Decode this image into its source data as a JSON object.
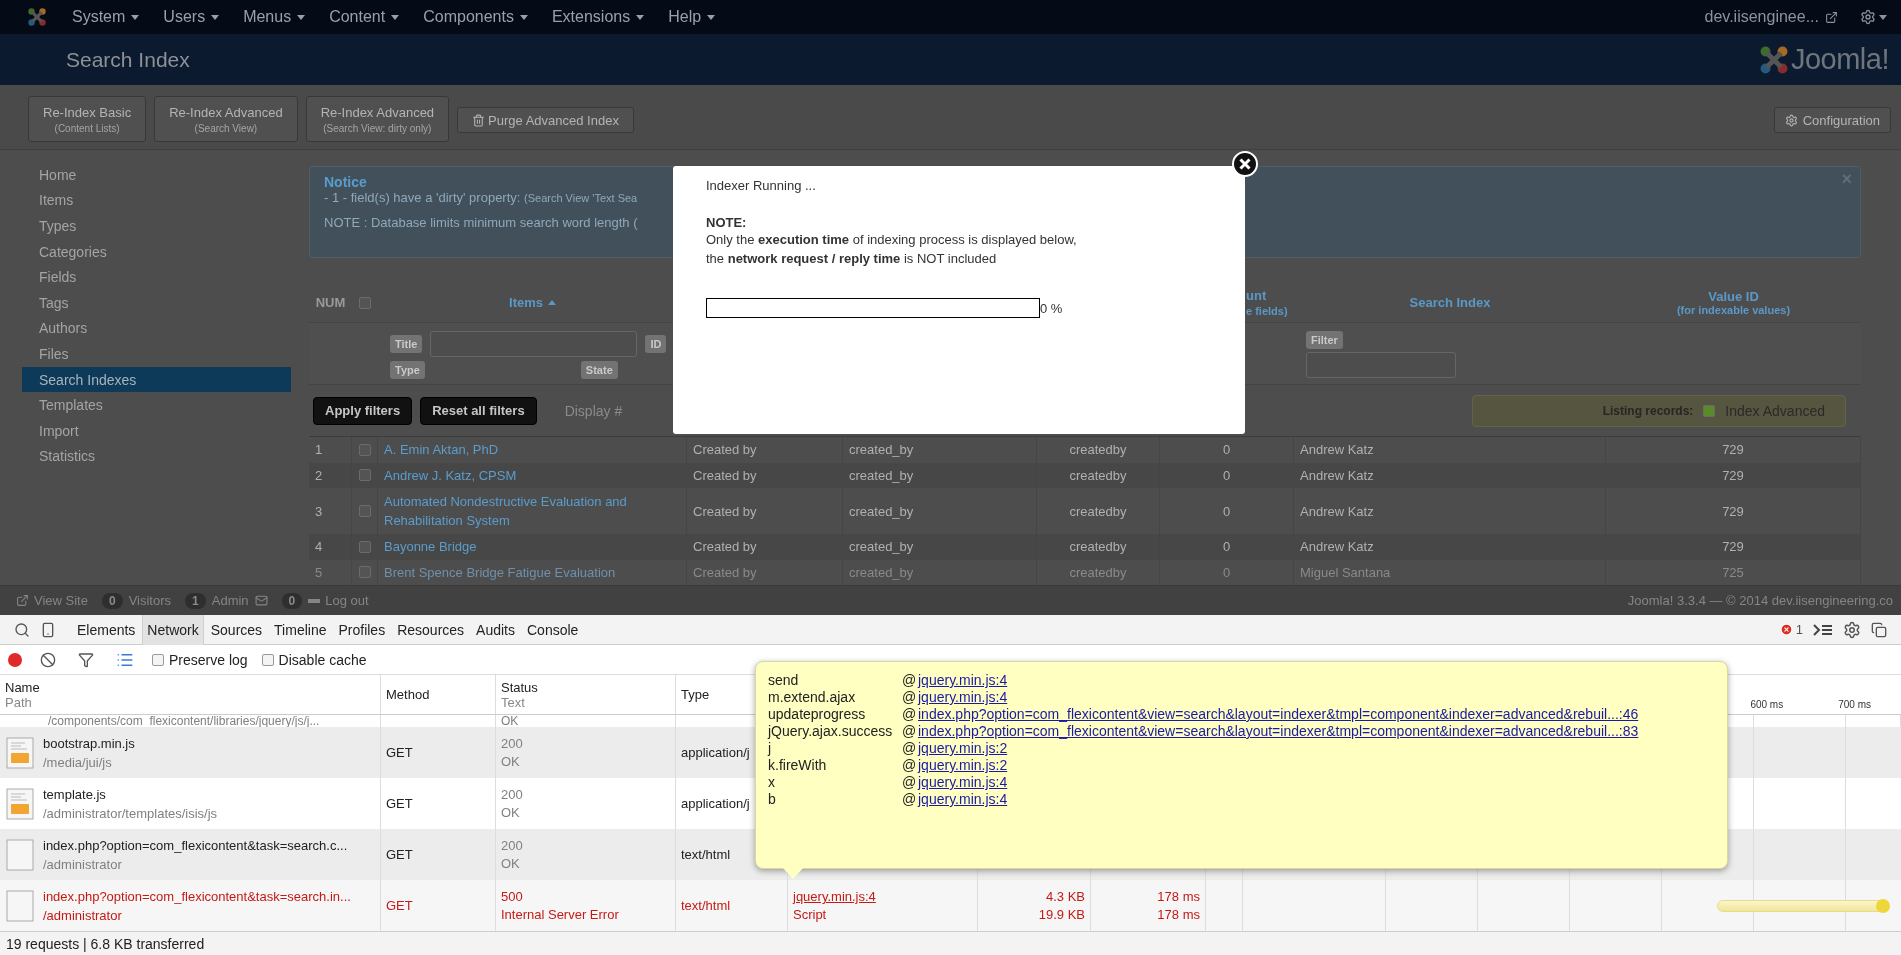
{
  "top_menu": {
    "items": [
      {
        "label": "System"
      },
      {
        "label": "Users"
      },
      {
        "label": "Menus"
      },
      {
        "label": "Content"
      },
      {
        "label": "Components"
      },
      {
        "label": "Extensions"
      },
      {
        "label": "Help"
      }
    ],
    "site_link": "dev.iisenginee..."
  },
  "header": {
    "title": "Search Index",
    "logo_text": "Joomla!"
  },
  "toolbar": {
    "buttons": [
      {
        "kind": "stacked",
        "label": "Re-Index Basic",
        "sublabel": "(Content Lists)"
      },
      {
        "kind": "stacked",
        "label": "Re-Index Advanced",
        "sublabel": "(Search View)"
      },
      {
        "kind": "stacked",
        "label": "Re-Index Advanced",
        "sublabel": "(Search View: dirty only)"
      },
      {
        "kind": "trash",
        "label": "Purge Advanced Index"
      }
    ],
    "configuration": "Configuration"
  },
  "sidebar": {
    "items": [
      {
        "label": "Home",
        "selected": false
      },
      {
        "label": "Items",
        "selected": false
      },
      {
        "label": "Types",
        "selected": false
      },
      {
        "label": "Categories",
        "selected": false
      },
      {
        "label": "Fields",
        "selected": false
      },
      {
        "label": "Tags",
        "selected": false
      },
      {
        "label": "Authors",
        "selected": false
      },
      {
        "label": "Files",
        "selected": false
      },
      {
        "label": "Search Indexes",
        "selected": true
      },
      {
        "label": "Templates",
        "selected": false
      },
      {
        "label": "Import",
        "selected": false
      },
      {
        "label": "Statistics",
        "selected": false
      }
    ]
  },
  "notice": {
    "title": "Notice",
    "line_1": "- 1 - field(s) have a 'dirty' property: ",
    "line_1_detail": "(Search View 'Text Sea",
    "line_2": "NOTE : Database limits minimum search word length (",
    "close": "×"
  },
  "table": {
    "num": "NUM",
    "all_checked": false,
    "items": "Items",
    "count_title": "unt",
    "count_sub": "e fields)",
    "search_index": "Search Index",
    "value_id": "Value ID",
    "value_id_sub": "(for indexable values)"
  },
  "filters": {
    "title_label": "Title",
    "id_label": "ID",
    "type_label": "Type",
    "state_label": "State",
    "filter_label": "Filter"
  },
  "actions": {
    "apply": "Apply filters",
    "reset": "Reset all filters",
    "display": "Display #",
    "listing_label": "Listing records:",
    "listing_option": "Index Advanced",
    "listing_checked": true
  },
  "rows": [
    {
      "num": "1",
      "checked": false,
      "faded": false,
      "title": "A. Emin Aktan, PhD",
      "field": "Created by",
      "field_name": "created_by",
      "index": "createdby",
      "count": "0",
      "value": "Andrew Katz",
      "value_id": "729"
    },
    {
      "num": "2",
      "checked": false,
      "faded": false,
      "title": "Andrew J. Katz, CPSM",
      "field": "Created by",
      "field_name": "created_by",
      "index": "createdby",
      "count": "0",
      "value": "Andrew Katz",
      "value_id": "729"
    },
    {
      "num": "3",
      "checked": false,
      "faded": false,
      "title": "Automated Nondestructive Evaluation and Rehabilitation System",
      "field": "Created by",
      "field_name": "created_by",
      "index": "createdby",
      "count": "0",
      "value": "Andrew Katz",
      "value_id": "729"
    },
    {
      "num": "4",
      "checked": false,
      "faded": false,
      "title": "Bayonne Bridge",
      "field": "Created by",
      "field_name": "created_by",
      "index": "createdby",
      "count": "0",
      "value": "Andrew Katz",
      "value_id": "729"
    },
    {
      "num": "5",
      "checked": false,
      "faded": true,
      "title": "Brent Spence Bridge Fatigue Evaluation",
      "field": "Created by",
      "field_name": "created_by",
      "index": "createdby",
      "count": "0",
      "value": "Miguel Santana",
      "value_id": "725"
    }
  ],
  "footer": {
    "view_site": "View Site",
    "visitors_count": "0",
    "visitors": "Visitors",
    "admin_count": "1",
    "admin": "Admin",
    "messages_count": "0",
    "logout": "Log out",
    "copyright": "Joomla! 3.3.4 — © 2014 dev.iisengineering.co"
  },
  "modal": {
    "title": "Indexer Running ...",
    "note_label": "NOTE:",
    "note_line_1": "Only the **execution time** of indexing process is displayed below,",
    "note_line_2": "the **network request / reply time** is NOT included",
    "progress": {
      "level": 0,
      "reading": "0 %"
    }
  },
  "devtools": {
    "tabs": [
      {
        "label": "Elements",
        "selected": false
      },
      {
        "label": "Network",
        "selected": true
      },
      {
        "label": "Sources",
        "selected": false
      },
      {
        "label": "Timeline",
        "selected": false
      },
      {
        "label": "Profiles",
        "selected": false
      },
      {
        "label": "Resources",
        "selected": false
      },
      {
        "label": "Audits",
        "selected": false
      },
      {
        "label": "Console",
        "selected": false
      }
    ],
    "error_count": "1",
    "recording": true,
    "options": [
      {
        "label": "Preserve log",
        "checked": false
      },
      {
        "label": "Disable cache",
        "checked": false
      }
    ],
    "columns": {
      "name": "Name",
      "path": "Path",
      "method": "Method",
      "status": "Status",
      "text": "Text",
      "type": "Type",
      "ticks": [
        "600 ms",
        "700 ms"
      ]
    },
    "requests": [
      {
        "kind": "partial",
        "path": "/components/com_flexicontent/libraries/jquery/js/j...",
        "status_text": "OK"
      },
      {
        "kind": "script",
        "error": false,
        "timeline_bar": false,
        "name": "bootstrap.min.js",
        "path": "/media/jui/js",
        "method": "GET",
        "status": "200",
        "status_text": "OK",
        "type": "application/j"
      },
      {
        "kind": "script",
        "error": false,
        "timeline_bar": false,
        "name": "template.js",
        "path": "/administrator/templates/isis/js",
        "method": "GET",
        "status": "200",
        "status_text": "OK",
        "type": "application/j"
      },
      {
        "kind": "document",
        "error": false,
        "timeline_bar": false,
        "name": "index.php?option=com_flexicontent&task=search.c...",
        "path": "/administrator",
        "method": "GET",
        "status": "200",
        "status_text": "OK",
        "type": "text/html"
      },
      {
        "kind": "document",
        "error": true,
        "timeline_bar": true,
        "name": "index.php?option=com_flexicontent&task=search.in...",
        "path": "/administrator",
        "method": "GET",
        "status": "500",
        "status_text": "Internal Server Error",
        "type": "text/html",
        "initiator": "jquery.min.js:4",
        "initiator_type": "Script",
        "size": "4.3 KB",
        "content_size": "19.9 KB",
        "time": "178 ms",
        "latency": "178 ms"
      }
    ],
    "status_bar": "19 requests | 6.8 KB transferred",
    "tooltip": {
      "frames": [
        {
          "function": "send",
          "at": "@",
          "link": "jquery.min.js:4"
        },
        {
          "function": "m.extend.ajax",
          "at": "@",
          "link": "jquery.min.js:4"
        },
        {
          "function": "updateprogress",
          "at": "@",
          "link": "index.php?option=com_flexicontent&view=search&layout=indexer&tmpl=component&indexer=advanced&rebuil...:46"
        },
        {
          "function": "jQuery.ajax.success",
          "at": "@",
          "link": "index.php?option=com_flexicontent&view=search&layout=indexer&tmpl=component&indexer=advanced&rebuil...:83"
        },
        {
          "function": "j",
          "at": "@",
          "link": "jquery.min.js:2"
        },
        {
          "function": "k.fireWith",
          "at": "@",
          "link": "jquery.min.js:2"
        },
        {
          "function": "x",
          "at": "@",
          "link": "jquery.min.js:4"
        },
        {
          "function": "b",
          "at": "@",
          "link": "jquery.min.js:4"
        }
      ]
    }
  }
}
